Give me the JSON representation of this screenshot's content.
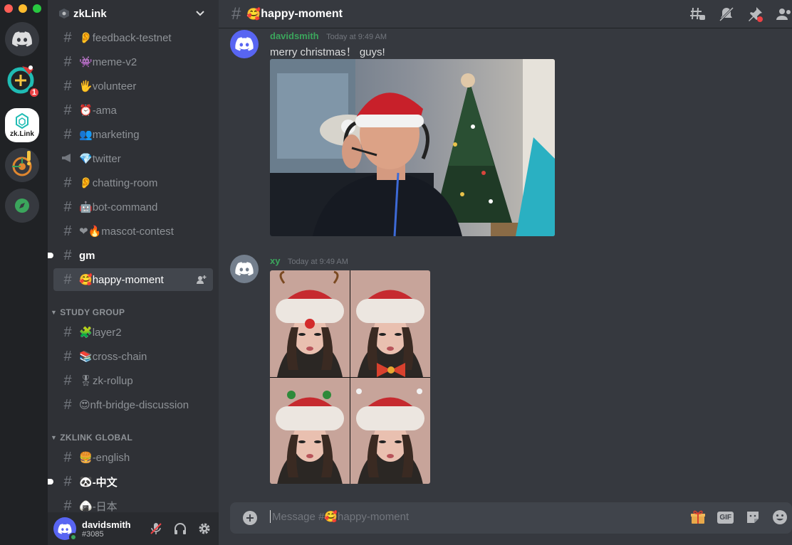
{
  "colors": {
    "rail": "#202225",
    "sidebar": "#2f3136",
    "chat": "#36393f",
    "blurple": "#5865f2",
    "green": "#3ba55c",
    "red": "#ed4245",
    "zk_teal": "#1fbcb4"
  },
  "server_rail": {
    "home_icon": "discord-logo-icon",
    "servers": [
      {
        "name": "christmas-server",
        "badge": "1"
      },
      {
        "name": "zklink-server",
        "label": "zk.Link",
        "active": true
      },
      {
        "name": "target-server"
      },
      {
        "name": "explore-server",
        "icon": "compass-icon"
      }
    ]
  },
  "server_header": {
    "name": "zkLink"
  },
  "channels": [
    {
      "emoji": "👂",
      "name": "feedback-testnet"
    },
    {
      "emoji": "👾",
      "name": "meme-v2"
    },
    {
      "emoji": "🖐",
      "name": "volunteer"
    },
    {
      "emoji": "⏰",
      "name": "-ama"
    },
    {
      "emoji": "👥",
      "name": "marketing"
    },
    {
      "emoji": "💎",
      "name": "twitter",
      "icon": "megaphone-icon"
    },
    {
      "emoji": "👂",
      "name": "chatting-room"
    },
    {
      "emoji": "🤖",
      "name": "bot-command"
    },
    {
      "emoji": "❤🔥",
      "name": "mascot-contest"
    },
    {
      "emoji": "",
      "name": "gm",
      "unread": true
    },
    {
      "emoji": "🥰",
      "name": "happy-moment",
      "active": true
    }
  ],
  "categories": [
    {
      "label": "STUDY GROUP",
      "channels": [
        {
          "emoji": "🧩",
          "name": "layer2"
        },
        {
          "emoji": "📚",
          "name": "cross-chain"
        },
        {
          "emoji": "🎖",
          "name": "zk-rollup"
        },
        {
          "emoji": "😍",
          "name": "nft-bridge-discussion"
        }
      ]
    },
    {
      "label": "ZKLINK GLOBAL",
      "channels": [
        {
          "emoji": "🍔",
          "name": "-english"
        },
        {
          "emoji": "🐼",
          "name": "-中文",
          "unread": true
        },
        {
          "emoji": "🍙",
          "name": "-日本"
        }
      ]
    }
  ],
  "user_panel": {
    "username": "davidsmith",
    "tag": "#3085",
    "status": "online"
  },
  "topbar": {
    "channel_emoji": "🥰",
    "channel_name": "happy-moment"
  },
  "messages": [
    {
      "author": "davidsmith",
      "timestamp": "Today at 9:49 AM",
      "text": "merry christmas！ guys!",
      "attachment": "christmas-photo"
    },
    {
      "author": "xy",
      "timestamp": "Today at 9:49 AM",
      "text": "",
      "attachment": "selfie-grid"
    }
  ],
  "composer": {
    "placeholder": "Message #🥰happy-moment",
    "gif_label": "GIF"
  }
}
